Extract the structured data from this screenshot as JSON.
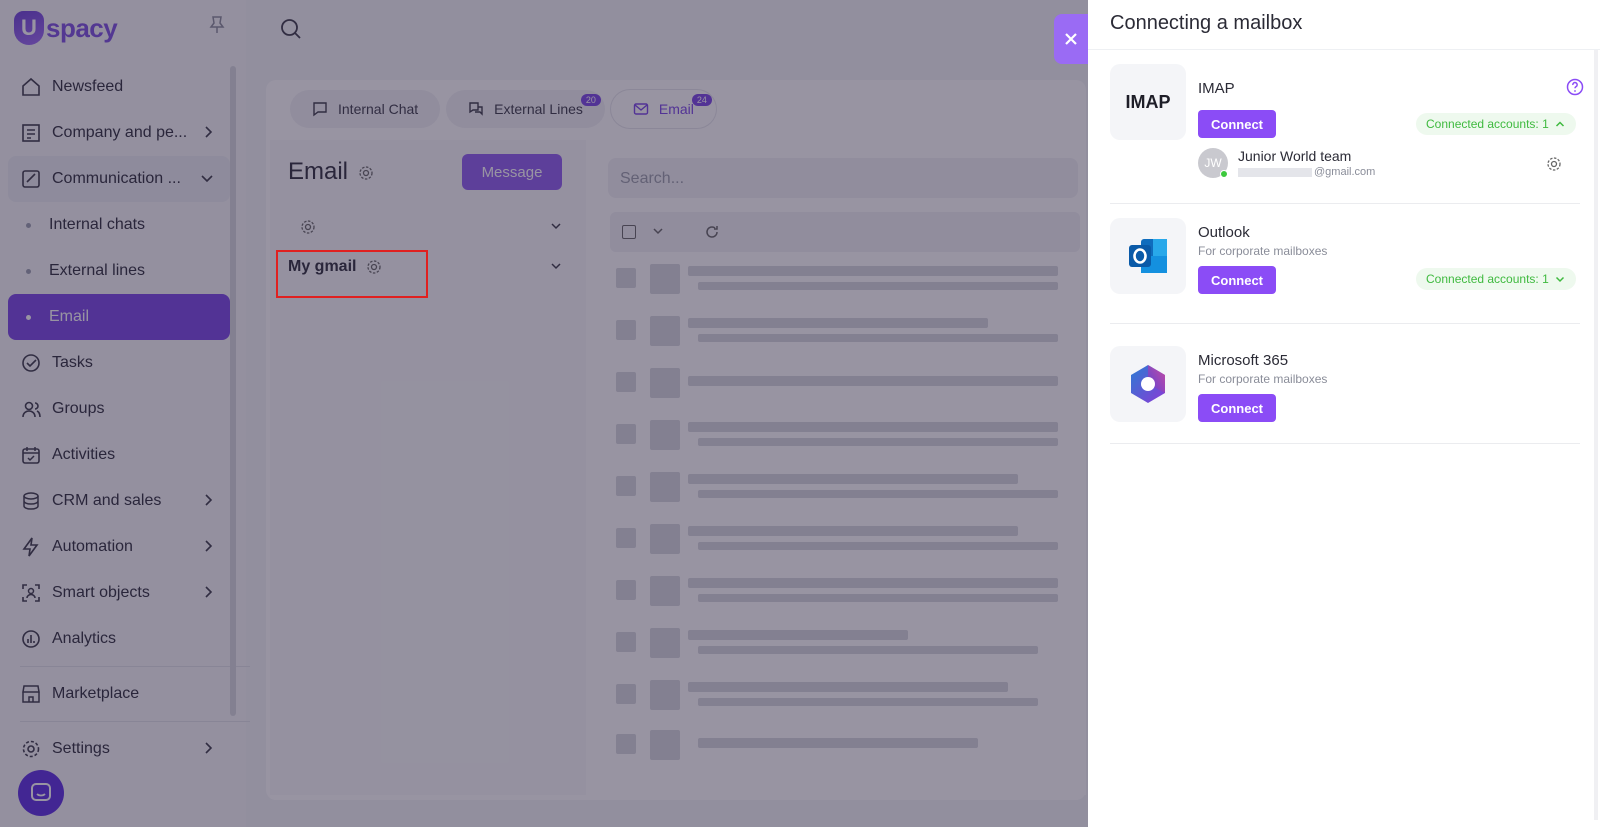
{
  "app": {
    "logo_text": "spacy",
    "logo_letter": "U"
  },
  "sidebar": {
    "items": [
      {
        "label": "Newsfeed"
      },
      {
        "label": "Company and pe..."
      },
      {
        "label": "Communication ..."
      },
      {
        "label": "Internal chats"
      },
      {
        "label": "External lines"
      },
      {
        "label": "Email"
      },
      {
        "label": "Tasks"
      },
      {
        "label": "Groups"
      },
      {
        "label": "Activities"
      },
      {
        "label": "CRM and sales"
      },
      {
        "label": "Automation"
      },
      {
        "label": "Smart objects"
      },
      {
        "label": "Analytics"
      },
      {
        "label": "Marketplace"
      },
      {
        "label": "Settings"
      }
    ]
  },
  "tabs": [
    {
      "label": "Internal Chat",
      "badge": ""
    },
    {
      "label": "External Lines",
      "badge": "20"
    },
    {
      "label": "Email",
      "badge": "24"
    }
  ],
  "email": {
    "title": "Email",
    "message_button": "Message",
    "account_name": "My gmail",
    "search_placeholder": "Search..."
  },
  "drawer": {
    "title": "Connecting a mailbox",
    "providers": [
      {
        "logo_text": "IMAP",
        "name": "IMAP",
        "subtitle": "",
        "connect_label": "Connect",
        "connected_label": "Connected accounts: 1",
        "account": {
          "initials": "JW",
          "name": "Junior World team",
          "email_suffix": "@gmail.com"
        }
      },
      {
        "logo_text": "",
        "name": "Outlook",
        "subtitle": "For corporate mailboxes",
        "connect_label": "Connect",
        "connected_label": "Connected accounts: 1"
      },
      {
        "logo_text": "",
        "name": "Microsoft 365",
        "subtitle": "For corporate mailboxes",
        "connect_label": "Connect"
      }
    ]
  },
  "colors": {
    "accent": "#8b4cf6",
    "connected_green": "#3fba3f",
    "highlight_red": "#e02020"
  }
}
